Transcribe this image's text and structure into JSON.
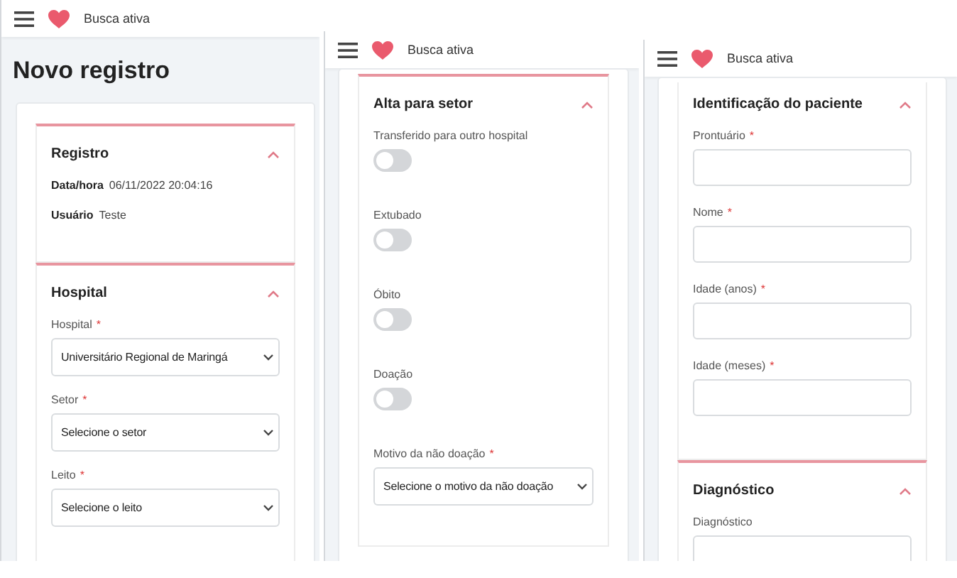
{
  "screens": [
    {
      "app_name": "Busca ativa",
      "page_title": "Novo registro",
      "sections": [
        {
          "title": "Registro",
          "expanded": true,
          "fields": [
            {
              "kind": "info",
              "label": "Data/hora",
              "value": "06/11/2022 20:04:16"
            },
            {
              "kind": "info",
              "label": "Usuário",
              "value": "Teste"
            }
          ]
        },
        {
          "title": "Hospital",
          "expanded": true,
          "fields": [
            {
              "kind": "select",
              "label": "Hospital",
              "required_mark": "*",
              "value": "Universitário Regional de Maringá"
            },
            {
              "kind": "select",
              "label": "Setor",
              "required_mark": "*",
              "placeholder": "Selecione o setor"
            },
            {
              "kind": "select",
              "label": "Leito",
              "required_mark": "*",
              "placeholder": "Selecione o leito"
            }
          ]
        }
      ]
    },
    {
      "app_name": "Busca ativa",
      "sections": [
        {
          "title": "Alta para setor",
          "expanded": true,
          "fields": [
            {
              "kind": "toggle",
              "label": "Transferido para outro hospital",
              "on": false
            },
            {
              "kind": "toggle",
              "label": "Extubado",
              "on": false
            },
            {
              "kind": "toggle",
              "label": "Óbito",
              "on": false
            },
            {
              "kind": "toggle",
              "label": "Doação",
              "on": false
            },
            {
              "kind": "select",
              "label": "Motivo da não doação",
              "required_mark": "*",
              "placeholder": "Selecione o motivo da não doação"
            }
          ]
        }
      ]
    },
    {
      "app_name": "Busca ativa",
      "sections": [
        {
          "title": "Identificação do paciente",
          "expanded": true,
          "fields": [
            {
              "kind": "text",
              "label": "Prontuário",
              "required_mark": "*"
            },
            {
              "kind": "text",
              "label": "Nome",
              "required_mark": "*"
            },
            {
              "kind": "text",
              "label": "Idade (anos)",
              "required_mark": "*"
            },
            {
              "kind": "text",
              "label": "Idade (meses)",
              "required_mark": "*"
            }
          ]
        },
        {
          "title": "Diagnóstico",
          "expanded": true,
          "fields": [
            {
              "kind": "text",
              "label": "Diagnóstico"
            }
          ]
        }
      ]
    }
  ]
}
